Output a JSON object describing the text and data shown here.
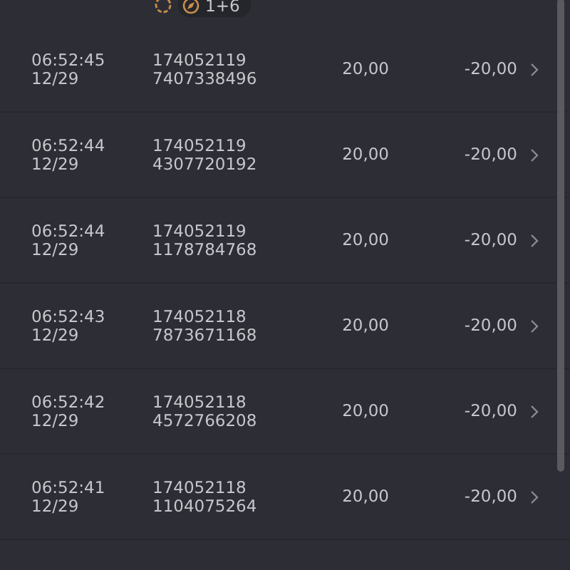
{
  "top_row": {
    "badge": "1+6"
  },
  "rows": [
    {
      "time": "06:52:45",
      "date": "12/29",
      "id": "174052119",
      "number": "7407338496",
      "amount": "20,00",
      "result": "-20,00"
    },
    {
      "time": "06:52:44",
      "date": "12/29",
      "id": "174052119",
      "number": "4307720192",
      "amount": "20,00",
      "result": "-20,00"
    },
    {
      "time": "06:52:44",
      "date": "12/29",
      "id": "174052119",
      "number": "1178784768",
      "amount": "20,00",
      "result": "-20,00"
    },
    {
      "time": "06:52:43",
      "date": "12/29",
      "id": "174052118",
      "number": "7873671168",
      "amount": "20,00",
      "result": "-20,00"
    },
    {
      "time": "06:52:42",
      "date": "12/29",
      "id": "174052118",
      "number": "4572766208",
      "amount": "20,00",
      "result": "-20,00"
    },
    {
      "time": "06:52:41",
      "date": "12/29",
      "id": "174052118",
      "number": "1104075264",
      "amount": "20,00",
      "result": "-20,00"
    }
  ]
}
